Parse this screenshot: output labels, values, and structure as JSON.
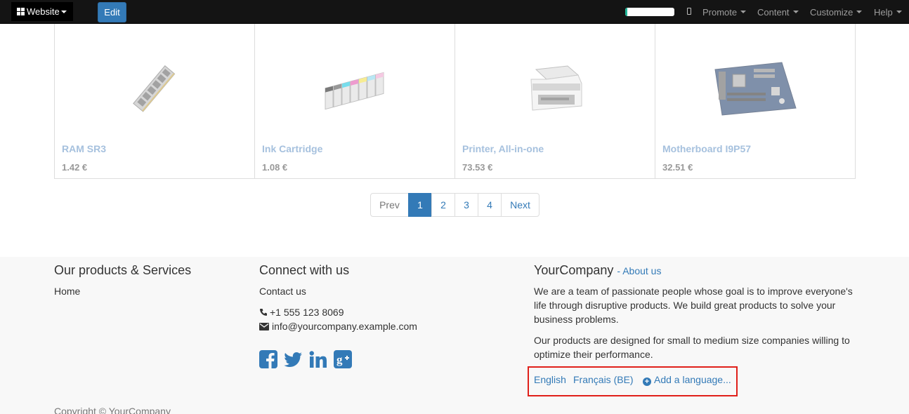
{
  "topbar": {
    "website_label": "Website",
    "edit_label": "Edit",
    "progress_fraction": 0.04,
    "menus": [
      "Promote",
      "Content",
      "Customize",
      "Help"
    ],
    "colors": {
      "bar": "#141414",
      "edit": "#337ab7",
      "progress": "#21b799"
    }
  },
  "products": [
    {
      "name": "RAM SR3",
      "price": "1.42 €",
      "image_icon": "ram-module-icon"
    },
    {
      "name": "Ink Cartridge",
      "price": "1.08 €",
      "image_icon": "ink-cartridge-icon"
    },
    {
      "name": "Printer, All-in-one",
      "price": "73.53 €",
      "image_icon": "printer-icon"
    },
    {
      "name": "Motherboard I9P57",
      "price": "32.51 €",
      "image_icon": "motherboard-icon"
    }
  ],
  "pager": {
    "prev": "Prev",
    "pages": [
      "1",
      "2",
      "3",
      "4"
    ],
    "active_page": "1",
    "next": "Next"
  },
  "footer": {
    "col1": {
      "title": "Our products & Services",
      "link_home": "Home"
    },
    "col2": {
      "title": "Connect with us",
      "contact": "Contact us",
      "phone": "+1 555 123 8069",
      "email": "info@yourcompany.example.com",
      "social": [
        "facebook-icon",
        "twitter-icon",
        "linkedin-icon",
        "google-plus-icon"
      ]
    },
    "col3": {
      "company": "YourCompany",
      "about_sep": "- ",
      "about": "About us",
      "para1": "We are a team of passionate people whose goal is to improve everyone's life through disruptive products. We build great products to solve your business problems.",
      "para2": "Our products are designed for small to medium size companies willing to optimize their performance."
    },
    "languages": {
      "english": "English",
      "french": "Français (BE)",
      "add": "Add a language..."
    },
    "copyright": "Copyright © YourCompany"
  }
}
